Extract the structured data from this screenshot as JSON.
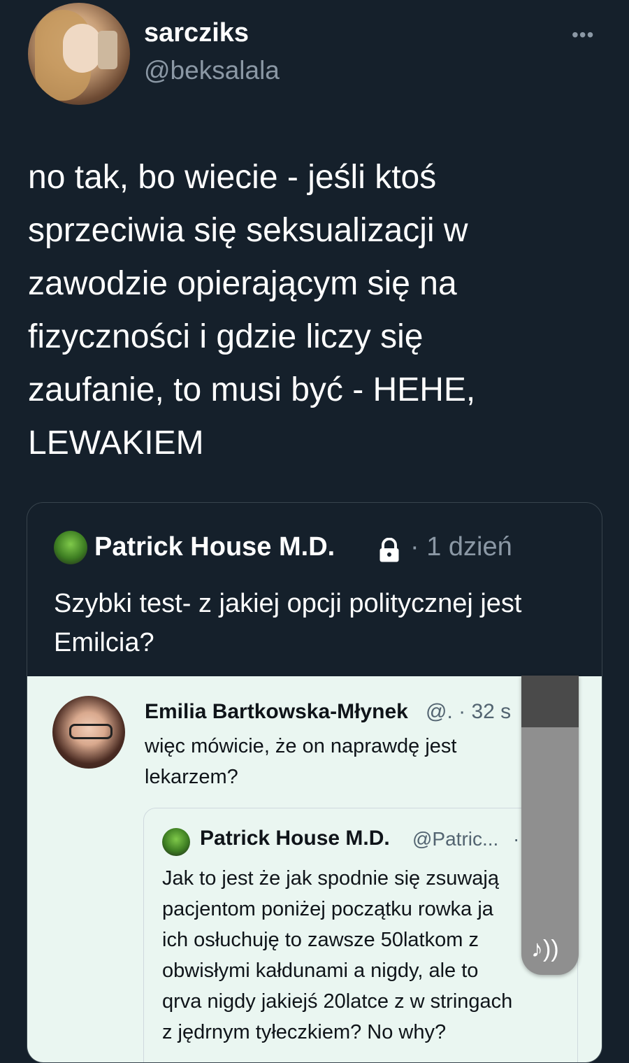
{
  "author": {
    "display_name": "sarcziks",
    "handle": "@beksalala",
    "more_icon": "more-horizontal-icon"
  },
  "tweet": {
    "text": "no tak, bo wiecie - jeśli ktoś\nsprzeciwia się seksualizacji w\nzawodzie opierającym się na\nfizyczności i gdzie liczy się\nzaufanie, to musi być - HEHE,\nLEWAKIEM"
  },
  "quote": {
    "name": "Patrick House M.D.",
    "lock_icon": "lock-icon",
    "time": "· 1 dzień",
    "text": "Szybki test- z jakiej opcji politycznej jest Emilcia?",
    "embed": {
      "name": "Emilia Bartkowska-Młynek",
      "handle": "@. · 32 s",
      "text": "więc mówicie, że on naprawdę jest lekarzem?",
      "inner": {
        "name": "Patrick House M.D.",
        "handle": "@Patric...",
        "dot": "·",
        "text": "Jak to jest że jak spodnie się zsuwają\npacjentom poniżej początku rowka ja\nich osłuchuję to zawsze  50latkom z\nobwisłymi kałdunami a nigdy,  ale to\nqrva nigdy jakiejś 20latce z w stringach\nz jędrnym tyłeczkiem? No why?"
      }
    }
  },
  "overlay": {
    "sound_icon": "sound-icon",
    "sound_glyph": "♪))"
  },
  "colors": {
    "background": "#15202b",
    "secondary_text": "#8b98a5",
    "embed_background": "#eaf6f1"
  }
}
